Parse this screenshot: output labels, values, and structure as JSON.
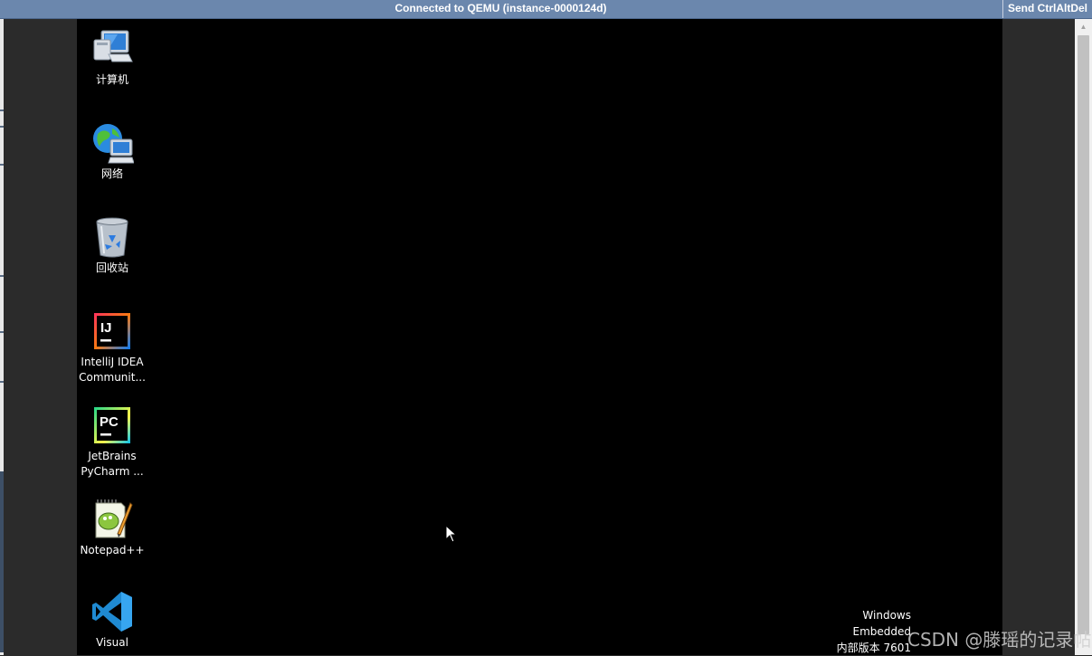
{
  "topbar": {
    "status": "Connected to QEMU (instance-0000124d)",
    "send_cad": "Send CtrlAltDel"
  },
  "desktop": {
    "icons": [
      {
        "label": "计算机",
        "icon": "computer-icon"
      },
      {
        "label": "网络",
        "icon": "network-icon"
      },
      {
        "label": "回收站",
        "icon": "recycle-bin-icon"
      },
      {
        "label": "IntelliJ IDEA Communit...",
        "icon": "intellij-idea-icon"
      },
      {
        "label": "JetBrains PyCharm ...",
        "icon": "pycharm-icon"
      },
      {
        "label": "Notepad++",
        "icon": "notepad-plus-plus-icon"
      },
      {
        "label": "Visual",
        "icon": "vscode-icon"
      }
    ],
    "watermark_line1": "Windows Embedded",
    "watermark_line2": "内部版本 7601",
    "csdn_overlay": "CSDN @滕瑶的记录帖"
  },
  "colors": {
    "topbar": "#6b87ad",
    "console": "#000000",
    "frame": "#2b2b2b"
  }
}
